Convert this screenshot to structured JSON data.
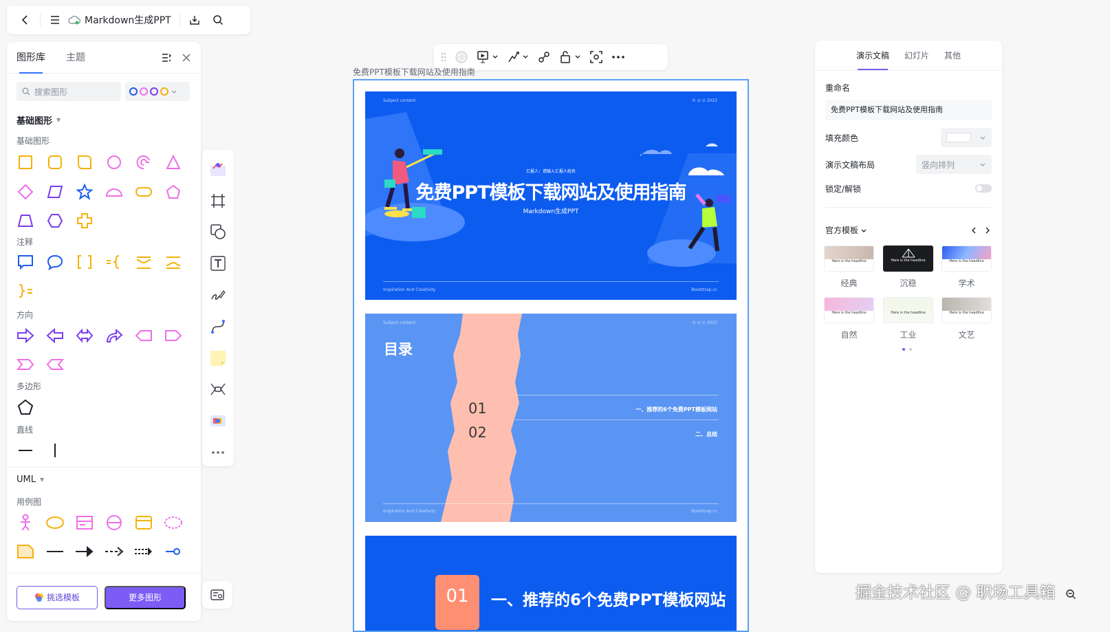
{
  "topbar": {
    "title": "Markdown生成PPT"
  },
  "left_panel": {
    "tabs": [
      "图形库",
      "主题"
    ],
    "search_placeholder": "搜索图形",
    "sections": {
      "basic": "基础图形",
      "basic_sub": "基础图形",
      "annotation": "注释",
      "direction": "方向",
      "polygon": "多边形",
      "line": "直线",
      "uml": "UML",
      "usecase": "用例图"
    },
    "buttons": {
      "pick_template": "挑选模板",
      "more_shapes": "更多图形"
    }
  },
  "canvas": {
    "frame_label": "免费PPT模板下载网站及使用指南",
    "slide1": {
      "top_left": "Subject content",
      "top_right": "© ⊙ ⊙ 2023",
      "reporter": "汇报人：请输入汇报人姓名",
      "title": "免费PPT模板下载网站及使用指南",
      "subtitle": "Markdown生成PPT",
      "bottom_left": "Inspiration And Creativity",
      "bottom_right": "Bootstrap.cc"
    },
    "slide2": {
      "top_left": "Subject content",
      "top_right": "© ⊙ ⊙ 2023",
      "title": "目录",
      "num1": "01",
      "num2": "02",
      "item1": "一、推荐的6个免费PPT模板网站",
      "item2": "二、总结",
      "bottom_left": "Inspiration And Creativity",
      "bottom_right": "Bootstrap.cc"
    },
    "slide3": {
      "num": "01",
      "title": "一、推荐的6个免费PPT模板网站"
    }
  },
  "right_panel": {
    "tabs": [
      "演示文稿",
      "幻灯片",
      "其他"
    ],
    "rename_label": "重命名",
    "rename_value": "免费PPT模板下载网站及使用指南",
    "fill_label": "填充颜色",
    "layout_label": "演示文稿布局",
    "layout_value": "竖向排列",
    "lock_label": "锁定/解锁",
    "lock_on": false,
    "templates_label": "官方模板",
    "template_caption": "Here is the headline",
    "templates": [
      "经典",
      "沉稳",
      "学术",
      "自然",
      "工业",
      "文艺"
    ]
  },
  "watermark": "掘金技术社区 @ 职场工具箱",
  "colors": {
    "accent": "#7b5cf5",
    "slide_blue": "#0d5cf0",
    "slide_light": "#5a95f3",
    "shape_yellow": "#f5b10b",
    "shape_pink": "#ee6ee8",
    "shape_purple": "#7b3cf0",
    "shape_blue": "#1a5cf0"
  }
}
